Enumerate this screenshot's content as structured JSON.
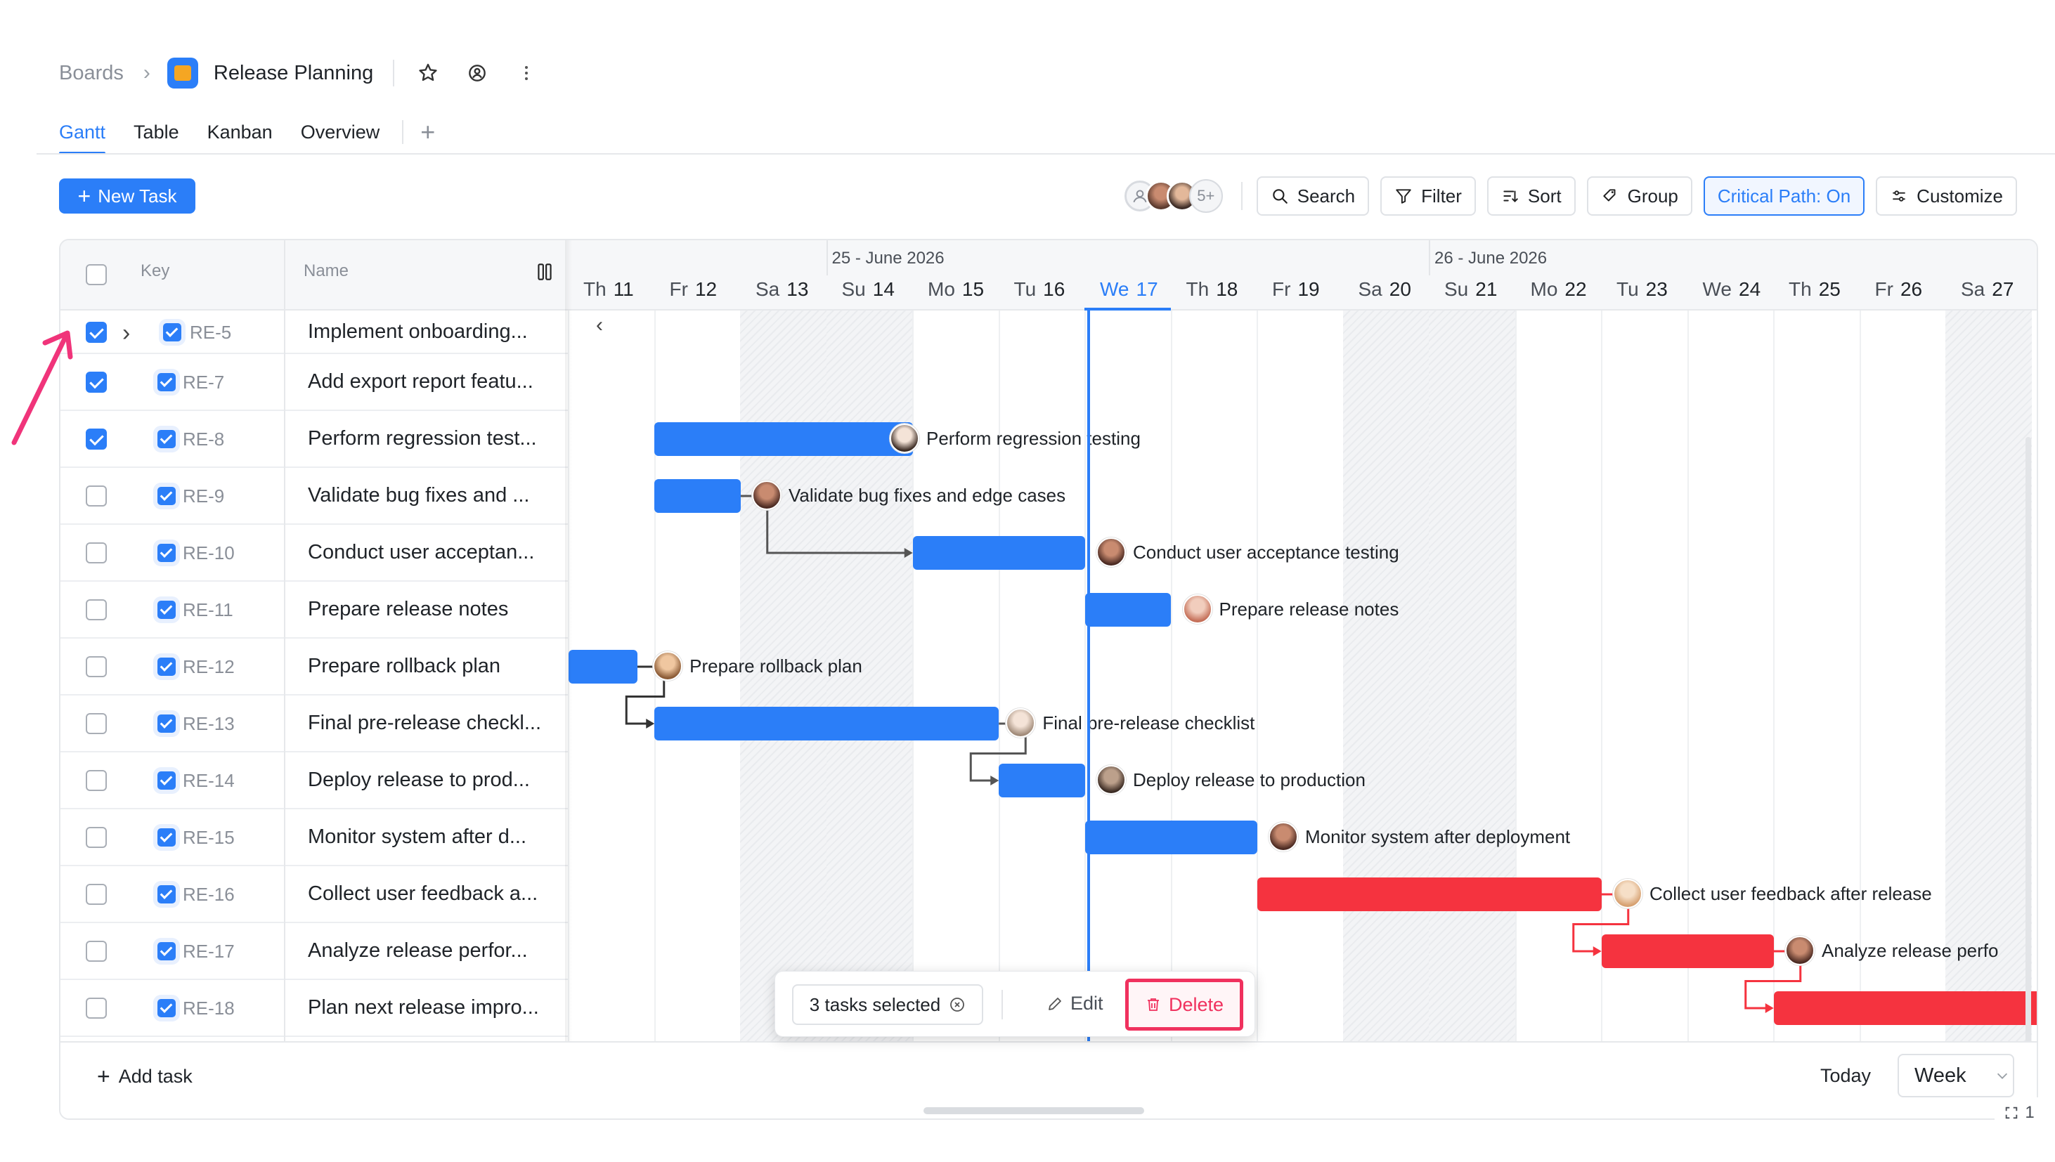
{
  "breadcrumb": {
    "root": "Boards",
    "title": "Release Planning"
  },
  "tabs": [
    {
      "label": "Gantt",
      "active": true
    },
    {
      "label": "Table"
    },
    {
      "label": "Kanban"
    },
    {
      "label": "Overview"
    }
  ],
  "toolbar": {
    "new_task": "New Task",
    "avatars_more": "5+",
    "search": "Search",
    "filter": "Filter",
    "sort": "Sort",
    "group": "Group",
    "critical_path": "Critical Path: On",
    "customize": "Customize"
  },
  "table": {
    "col_key": "Key",
    "col_name": "Name",
    "rows": [
      {
        "key": "RE-5",
        "name": "Implement onboarding...",
        "checked": true
      },
      {
        "key": "RE-7",
        "name": "Add export report featu...",
        "checked": true
      },
      {
        "key": "RE-8",
        "name": "Perform regression test...",
        "checked": true
      },
      {
        "key": "RE-9",
        "name": "Validate bug fixes and ...",
        "checked": false
      },
      {
        "key": "RE-10",
        "name": "Conduct user acceptan...",
        "checked": false
      },
      {
        "key": "RE-11",
        "name": "Prepare release notes",
        "checked": false
      },
      {
        "key": "RE-12",
        "name": "Prepare rollback plan",
        "checked": false
      },
      {
        "key": "RE-13",
        "name": "Final pre-release checkl...",
        "checked": false
      },
      {
        "key": "RE-14",
        "name": "Deploy release to prod...",
        "checked": false
      },
      {
        "key": "RE-15",
        "name": "Monitor system after d...",
        "checked": false
      },
      {
        "key": "RE-16",
        "name": "Collect user feedback a...",
        "checked": false
      },
      {
        "key": "RE-17",
        "name": "Analyze release perfor...",
        "checked": false
      },
      {
        "key": "RE-18",
        "name": "Plan next release impro...",
        "checked": false
      }
    ]
  },
  "timeline": {
    "weeks": [
      {
        "label": "25 - June 2026"
      },
      {
        "label": "26 - June 2026"
      }
    ],
    "days": [
      {
        "dow": "Th",
        "num": "11"
      },
      {
        "dow": "Fr",
        "num": "12"
      },
      {
        "dow": "Sa",
        "num": "13",
        "weekend": true
      },
      {
        "dow": "Su",
        "num": "14",
        "weekend": true
      },
      {
        "dow": "Mo",
        "num": "15"
      },
      {
        "dow": "Tu",
        "num": "16"
      },
      {
        "dow": "We",
        "num": "17",
        "today": true
      },
      {
        "dow": "Th",
        "num": "18"
      },
      {
        "dow": "Fr",
        "num": "19"
      },
      {
        "dow": "Sa",
        "num": "20",
        "weekend": true
      },
      {
        "dow": "Su",
        "num": "21",
        "weekend": true
      },
      {
        "dow": "Mo",
        "num": "22"
      },
      {
        "dow": "Tu",
        "num": "23"
      },
      {
        "dow": "We",
        "num": "24"
      },
      {
        "dow": "Th",
        "num": "25"
      },
      {
        "dow": "Fr",
        "num": "26"
      },
      {
        "dow": "Sa",
        "num": "27",
        "weekend": true
      }
    ],
    "tasks": [
      {
        "row": 2,
        "label": "Perform regression testing",
        "color": "#2b7ef8"
      },
      {
        "row": 3,
        "label": "Validate bug fixes and edge cases",
        "color": "#2b7ef8"
      },
      {
        "row": 4,
        "label": "Conduct user acceptance testing",
        "color": "#2b7ef8"
      },
      {
        "row": 5,
        "label": "Prepare release notes",
        "color": "#2b7ef8"
      },
      {
        "row": 6,
        "label": "Prepare rollback plan",
        "color": "#2b7ef8"
      },
      {
        "row": 7,
        "label": "Final pre-release checklist",
        "color": "#2b7ef8"
      },
      {
        "row": 8,
        "label": "Deploy release to production",
        "color": "#2b7ef8"
      },
      {
        "row": 9,
        "label": "Monitor system after deployment",
        "color": "#2b7ef8"
      },
      {
        "row": 10,
        "label": "Collect user feedback after release",
        "color": "#f5333f"
      },
      {
        "row": 11,
        "label": "Analyze release perfo",
        "color": "#f5333f"
      },
      {
        "row": 12,
        "label": "",
        "color": "#f5333f"
      }
    ]
  },
  "footer": {
    "add_task": "Add task",
    "today": "Today",
    "view": "Week",
    "zoom": "1"
  },
  "selection": {
    "count": "3 tasks selected",
    "edit": "Edit",
    "delete": "Delete"
  },
  "colors": {
    "accent": "#2b7ef8",
    "critical": "#f5333f",
    "danger": "#f0315e"
  }
}
